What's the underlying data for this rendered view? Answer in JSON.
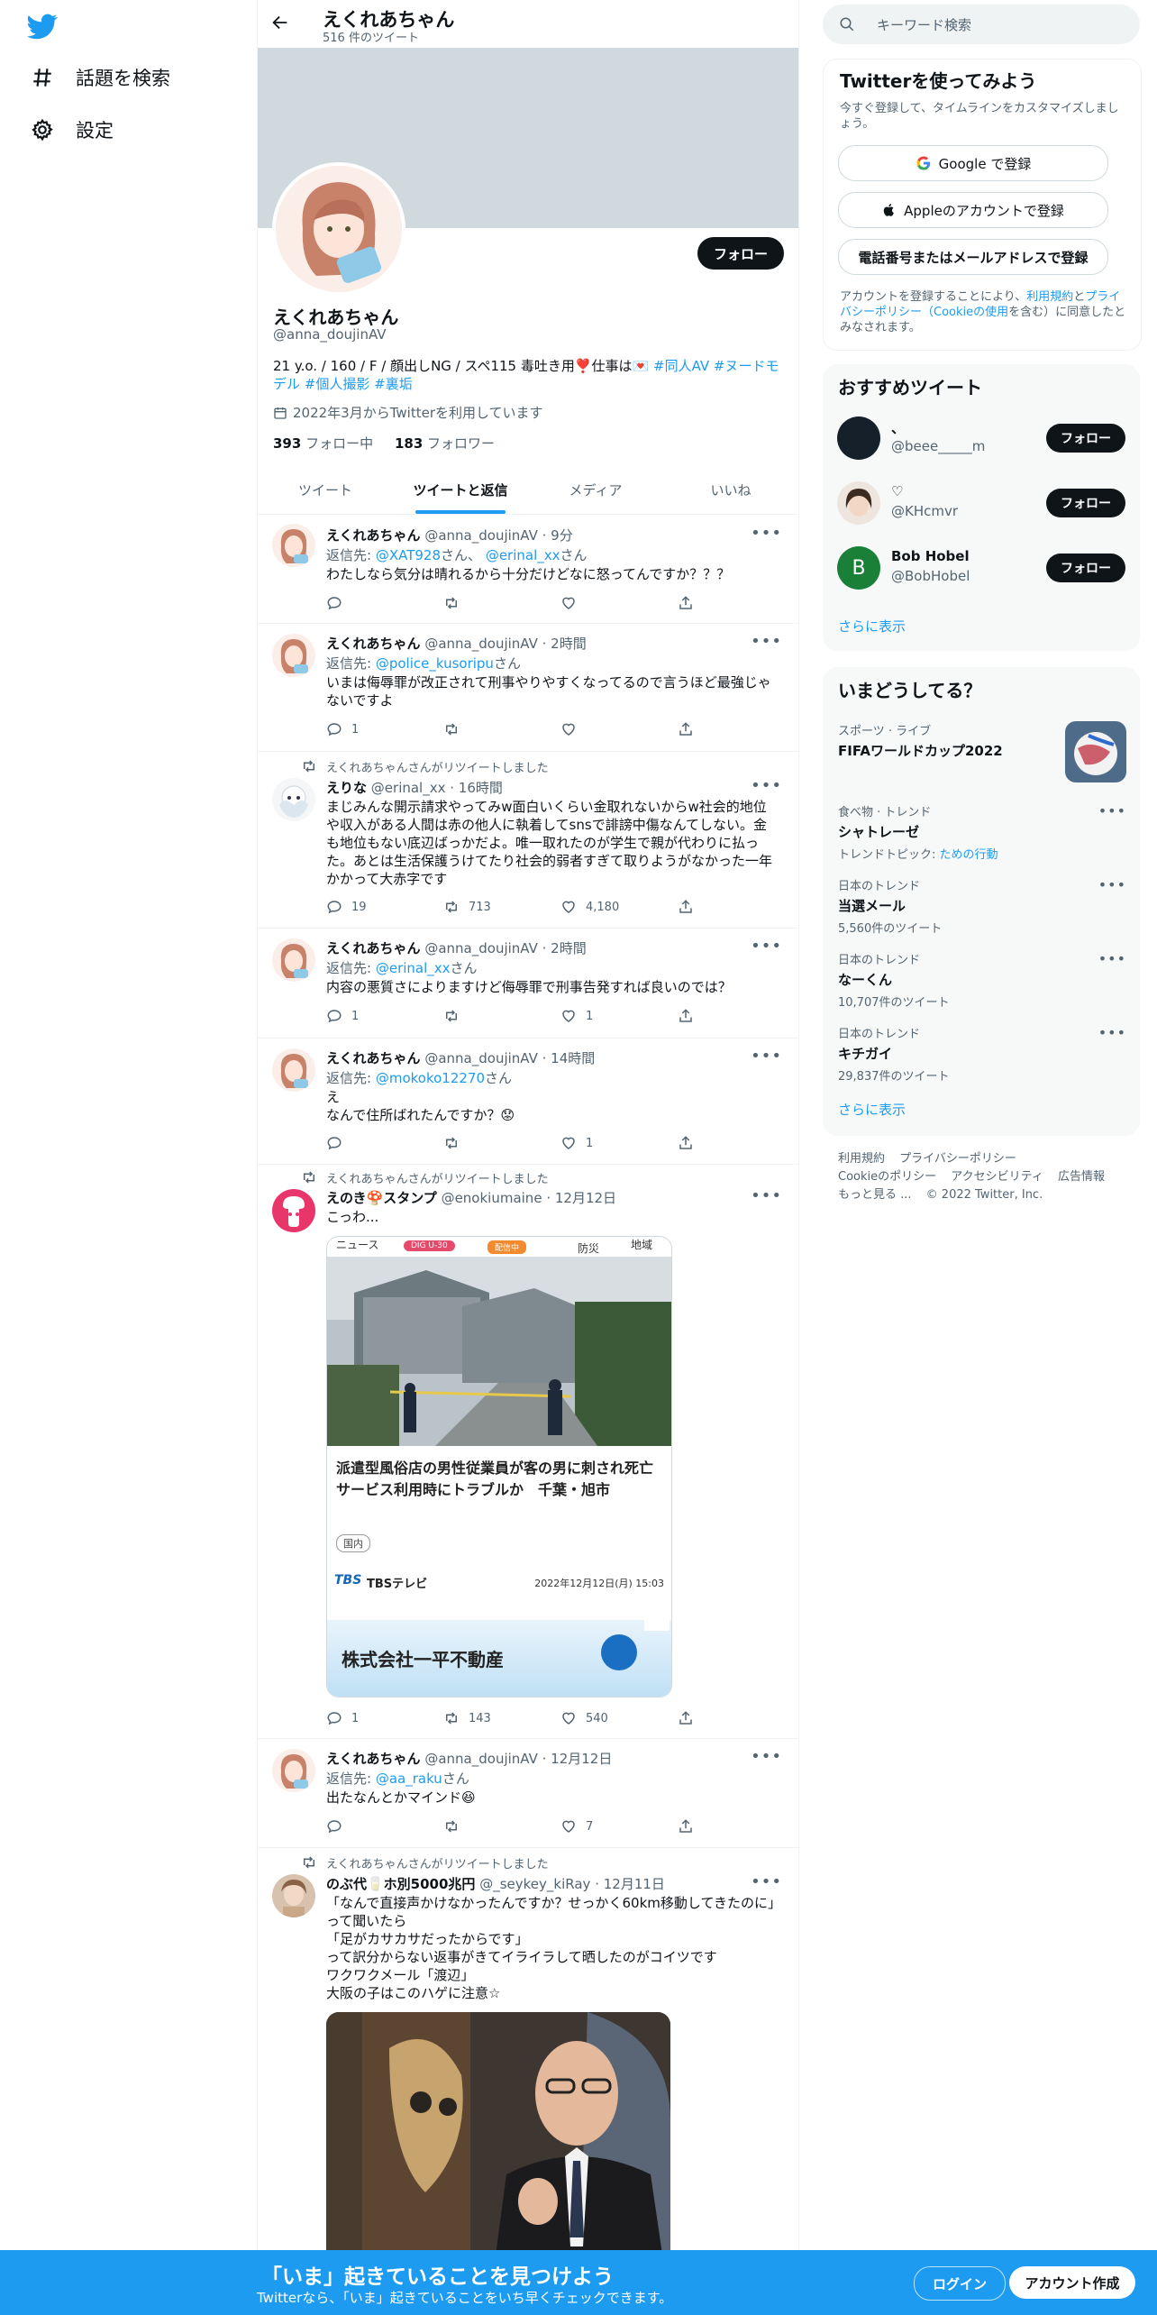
{
  "nav": {
    "explore": "話題を検索",
    "settings": "設定"
  },
  "header": {
    "title": "えくれあちゃん",
    "tweet_count": "516 件のツイート"
  },
  "profile": {
    "name": "えくれあちゃん",
    "handle": "@anna_doujinAV",
    "follow": "フォロー",
    "bio_text": "21 y.o. / 160 / F / 顔出しNG / スペ115 毒吐き用❣️仕事は💌",
    "bio_tags": [
      "#同人AV",
      "#ヌードモデル",
      "#個人撮影",
      "#裏垢"
    ],
    "joined": "2022年3月からTwitterを利用しています",
    "following_count": "393",
    "following_label": "フォロー中",
    "followers_count": "183",
    "followers_label": "フォロワー"
  },
  "tabs": [
    "ツイート",
    "ツイートと返信",
    "メディア",
    "いいね"
  ],
  "tweets": [
    {
      "name": "えくれあちゃん",
      "handle": "@anna_doujinAV",
      "time": "9分",
      "reply_prefix": "返信先:",
      "reply_to": "@XAT928",
      "reply_mid": "さん、",
      "reply_to2": "@erinal_xx",
      "reply_suffix": "さん",
      "text": "わたしなら気分は晴れるから十分だけどなに怒ってんですか？？？",
      "replies": "",
      "retweets": "",
      "likes": ""
    },
    {
      "name": "えくれあちゃん",
      "handle": "@anna_doujinAV",
      "time": "2時間",
      "reply_prefix": "返信先:",
      "reply_to": "@police_kusoripu",
      "reply_suffix": "さん",
      "text": "いまは侮辱罪が改正されて刑事やりやすくなってるので言うほど最強じゃないですよ",
      "replies": "1",
      "retweets": "",
      "likes": ""
    },
    {
      "retweet_label": "えくれあちゃんさんがリツイートしました",
      "name": "えりな",
      "handle": "@erinal_xx",
      "time": "16時間",
      "text": "まじみんな開示請求やってみw面白いくらい金取れないからw社会的地位や収入がある人間は赤の他人に執着してsnsで誹謗中傷なんてしない。金も地位もない底辺ばっかだよ。唯一取れたのが学生で親が代わりに払った。あとは生活保護うけてたり社会的弱者すぎて取りようがなかった一年かかって大赤字です",
      "replies": "19",
      "retweets": "713",
      "likes": "4,180"
    },
    {
      "name": "えくれあちゃん",
      "handle": "@anna_doujinAV",
      "time": "2時間",
      "reply_prefix": "返信先:",
      "reply_to": "@erinal_xx",
      "reply_suffix": "さん",
      "text": "内容の悪質さによりますけど侮辱罪で刑事告発すれば良いのでは？",
      "replies": "1",
      "retweets": "",
      "likes": "1"
    },
    {
      "name": "えくれあちゃん",
      "handle": "@anna_doujinAV",
      "time": "14時間",
      "reply_prefix": "返信先:",
      "reply_to": "@mokoko12270",
      "reply_suffix": "さん",
      "text": "え\nなんで住所ばれたんですか？😟",
      "replies": "",
      "retweets": "",
      "likes": "1"
    },
    {
      "retweet_label": "えくれあちゃんさんがリツイートしました",
      "name": "えのき🍄スタンプ",
      "handle": "@enokiumaine",
      "time": "12月12日",
      "text": "こっわ...",
      "card": {
        "tabs": [
          "ニュース",
          "防災",
          "地域"
        ],
        "badge1": "DIG U-30",
        "badge2": "配信中",
        "headline": "派遣型風俗店の男性従業員が客の男に刺され死亡　サービス利用時にトラブルか　千葉・旭市",
        "tag": "国内",
        "source_logo": "TBS",
        "source": "TBSテレビ",
        "date": "2022年12月12日(月) 15:03",
        "ad_text": "株式会社一平不動産"
      },
      "replies": "1",
      "retweets": "143",
      "likes": "540"
    },
    {
      "name": "えくれあちゃん",
      "handle": "@anna_doujinAV",
      "time": "12月12日",
      "reply_prefix": "返信先:",
      "reply_to": "@aa_raku",
      "reply_suffix": "さん",
      "text": "出たなんとかマインド😆",
      "replies": "",
      "retweets": "",
      "likes": "7"
    },
    {
      "retweet_label": "えくれあちゃんさんがリツイートしました",
      "name": "のぶ代🥛ホ別5000兆円",
      "handle": "@_seykey_kiRay",
      "time": "12月11日",
      "text": "「なんで直接声かけなかったんですか？せっかく60km移動してきたのに」って聞いたら\n「足がカサカサだったからです」\nって訳分からない返事がきてイライラして晒したのがコイツです\nワクワクメール「渡辺」\n大阪の子はこのハゲに注意☆"
    }
  ],
  "right": {
    "search_placeholder": "キーワード検索",
    "signup": {
      "title": "Twitterを使ってみよう",
      "subtitle": "今すぐ登録して、タイムラインをカスタマイズしましょう。",
      "google": "Google で登録",
      "apple": "Appleのアカウントで登録",
      "phone": "電話番号またはメールアドレスで登録",
      "legal_1": "アカウントを登録することにより、",
      "legal_terms": "利用規約",
      "legal_2": "と",
      "legal_privacy": "プライバシーポリシー（Cookieの使用",
      "legal_3": "を含む）に同意したとみなされます。"
    },
    "recommend": {
      "title": "おすすめツイート",
      "follow": "フォロー",
      "users": [
        {
          "name": "、",
          "handle": "@beee_____m"
        },
        {
          "name": "♡",
          "handle": "@KHcmvr"
        },
        {
          "name": "Bob Hobel",
          "handle": "@BobHobel",
          "initial": "B"
        }
      ],
      "more": "さらに表示"
    },
    "trends": {
      "title": "いまどうしてる？",
      "items": [
        {
          "cat": "スポーツ · ライブ",
          "title": "FIFAワールドカップ2022"
        },
        {
          "cat": "食べ物 · トレンド",
          "title": "シャトレーゼ",
          "topic_prefix": "トレンドトピック:",
          "topic": "ための行動"
        },
        {
          "cat": "日本のトレンド",
          "title": "当選メール",
          "count": "5,560件のツイート"
        },
        {
          "cat": "日本のトレンド",
          "title": "なーくん",
          "count": "10,707件のツイート"
        },
        {
          "cat": "日本のトレンド",
          "title": "キチガイ",
          "count": "29,837件のツイート"
        }
      ],
      "more": "さらに表示"
    },
    "footer": [
      "利用規約",
      "プライバシーポリシー",
      "Cookieのポリシー",
      "アクセシビリティ",
      "広告情報",
      "もっと見る ...",
      "© 2022 Twitter, Inc."
    ]
  },
  "bottom_bar": {
    "title": "「いま」起きていることを見つけよう",
    "subtitle": "Twitterなら、「いま」起きていることをいち早くチェックできます。",
    "login": "ログイン",
    "signup": "アカウント作成"
  },
  "colors": {
    "accent": "#1d9bf0",
    "text": "#0f1419",
    "muted": "#536471"
  }
}
